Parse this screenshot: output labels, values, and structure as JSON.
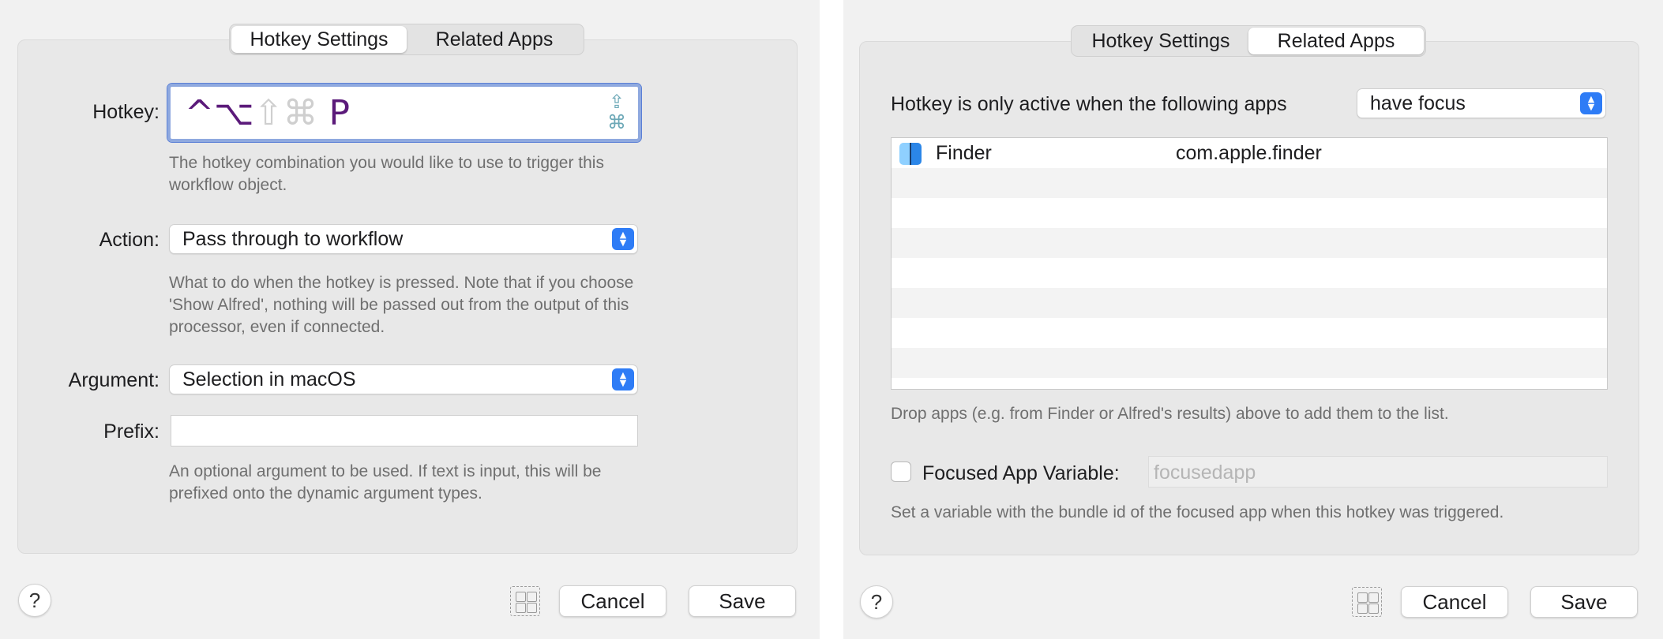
{
  "left_panel": {
    "tabs": [
      {
        "label": "Hotkey Settings",
        "active": true
      },
      {
        "label": "Related Apps",
        "active": false
      }
    ],
    "hotkey": {
      "label": "Hotkey:",
      "modifiers": [
        {
          "glyph": "^",
          "active": true
        },
        {
          "glyph": "⌥",
          "active": true
        },
        {
          "glyph": "⇧",
          "active": false
        },
        {
          "glyph": "⌘",
          "active": false
        }
      ],
      "key": "P",
      "side_icons": [
        "⇪",
        "⌘"
      ],
      "help": "The hotkey combination you would like to use to trigger this workflow object."
    },
    "action": {
      "label": "Action:",
      "value": "Pass through to workflow",
      "help": "What to do when the hotkey is pressed. Note that if you choose 'Show Alfred', nothing will be passed out from the output of this processor, even if connected."
    },
    "argument": {
      "label": "Argument:",
      "value": "Selection in macOS"
    },
    "prefix": {
      "label": "Prefix:",
      "value": "",
      "help": "An optional argument to be used. If text is input, this will be prefixed onto the dynamic argument types."
    },
    "footer": {
      "help_label": "?",
      "cancel_label": "Cancel",
      "save_label": "Save"
    }
  },
  "right_panel": {
    "tabs": [
      {
        "label": "Hotkey Settings",
        "active": false
      },
      {
        "label": "Related Apps",
        "active": true
      }
    ],
    "active_when": {
      "label": "Hotkey is only active when the following apps",
      "value": "have focus"
    },
    "apps": [
      {
        "name": "Finder",
        "bundle_id": "com.apple.finder",
        "icon": "finder-icon"
      }
    ],
    "drop_help": "Drop apps (e.g. from Finder or Alfred's results) above to add them to the list.",
    "focused_var": {
      "label": "Focused App Variable:",
      "checked": false,
      "placeholder": "focusedapp",
      "help": "Set a variable with the bundle id of the focused app when this hotkey was triggered."
    },
    "footer": {
      "help_label": "?",
      "cancel_label": "Cancel",
      "save_label": "Save"
    }
  },
  "colors": {
    "accent": "#2e7cf6",
    "hotkey_active": "#5b1a7a",
    "hotkey_inactive": "#cfcfcf",
    "panel_bg": "#f1f1f1",
    "group_bg": "#e8e8e8"
  }
}
